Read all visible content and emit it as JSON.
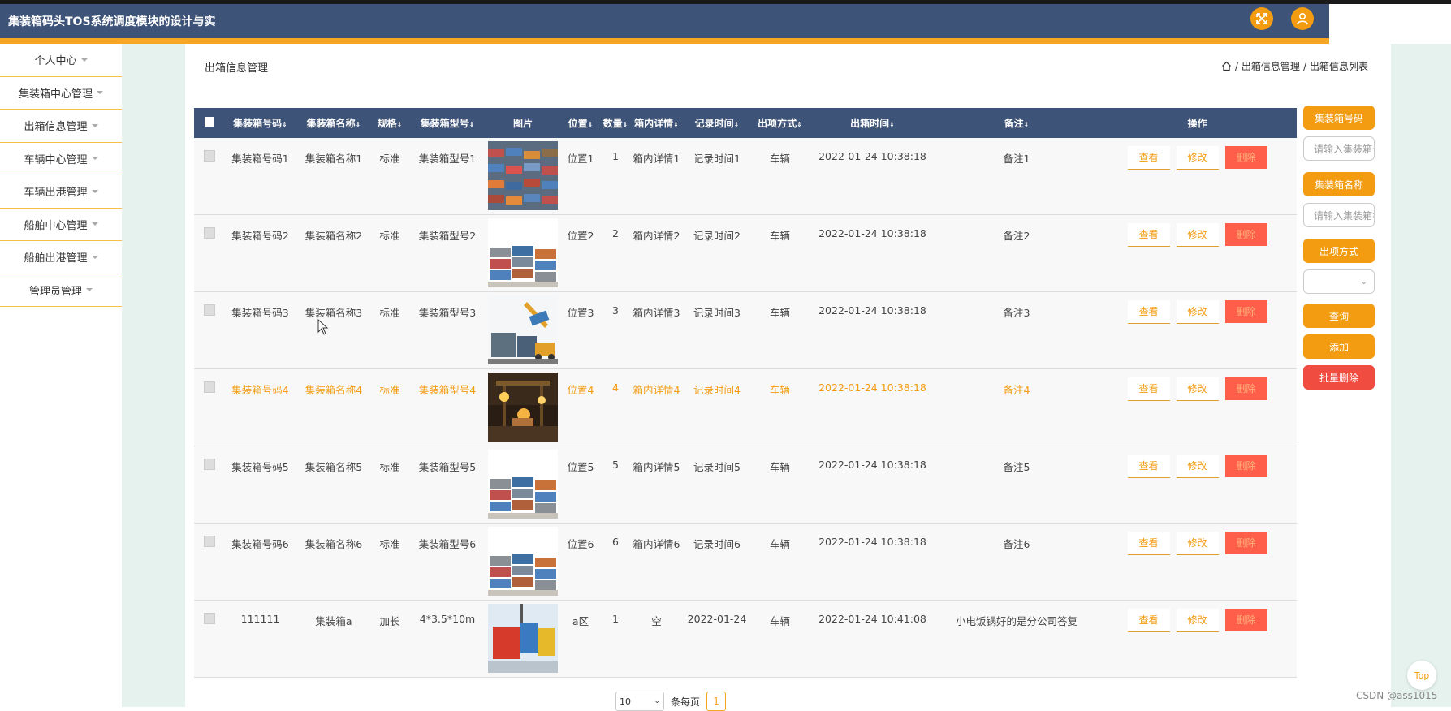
{
  "header": {
    "title": "集装箱码头TOS系统调度模块的设计与实"
  },
  "sidebar": {
    "items": [
      {
        "label": "个人中心"
      },
      {
        "label": "集装箱中心管理"
      },
      {
        "label": "出箱信息管理"
      },
      {
        "label": "车辆中心管理"
      },
      {
        "label": "车辆出港管理"
      },
      {
        "label": "船舶中心管理"
      },
      {
        "label": "船舶出港管理"
      },
      {
        "label": "管理员管理"
      }
    ]
  },
  "page": {
    "title": "出箱信息管理"
  },
  "breadcrumb": {
    "home_sep": "/",
    "level1": "出箱信息管理",
    "sep": "/",
    "level2": "出箱信息列表"
  },
  "table": {
    "headers": {
      "code": "集装箱号码",
      "name": "集装箱名称",
      "spec": "规格",
      "type": "集装箱型号",
      "image": "图片",
      "position": "位置",
      "quantity": "数量",
      "detail": "箱内详情",
      "record_time": "记录时间",
      "method": "出项方式",
      "out_time": "出箱时间",
      "remark": "备注",
      "ops": "操作"
    },
    "sort_glyph": "⇕",
    "rows": [
      {
        "code": "集装箱号码1",
        "name": "集装箱名称1",
        "spec": "标准",
        "type": "集装箱型号1",
        "position": "位置1",
        "quantity": "1",
        "detail": "箱内详情1",
        "record_time": "记录时间1",
        "method": "车辆",
        "out_time": "2022-01-24 10:38:18",
        "remark": "备注1"
      },
      {
        "code": "集装箱号码2",
        "name": "集装箱名称2",
        "spec": "标准",
        "type": "集装箱型号2",
        "position": "位置2",
        "quantity": "2",
        "detail": "箱内详情2",
        "record_time": "记录时间2",
        "method": "车辆",
        "out_time": "2022-01-24 10:38:18",
        "remark": "备注2"
      },
      {
        "code": "集装箱号码3",
        "name": "集装箱名称3",
        "spec": "标准",
        "type": "集装箱型号3",
        "position": "位置3",
        "quantity": "3",
        "detail": "箱内详情3",
        "record_time": "记录时间3",
        "method": "车辆",
        "out_time": "2022-01-24 10:38:18",
        "remark": "备注3"
      },
      {
        "code": "集装箱号码4",
        "name": "集装箱名称4",
        "spec": "标准",
        "type": "集装箱型号4",
        "position": "位置4",
        "quantity": "4",
        "detail": "箱内详情4",
        "record_time": "记录时间4",
        "method": "车辆",
        "out_time": "2022-01-24 10:38:18",
        "remark": "备注4"
      },
      {
        "code": "集装箱号码5",
        "name": "集装箱名称5",
        "spec": "标准",
        "type": "集装箱型号5",
        "position": "位置5",
        "quantity": "5",
        "detail": "箱内详情5",
        "record_time": "记录时间5",
        "method": "车辆",
        "out_time": "2022-01-24 10:38:18",
        "remark": "备注5"
      },
      {
        "code": "集装箱号码6",
        "name": "集装箱名称6",
        "spec": "标准",
        "type": "集装箱型号6",
        "position": "位置6",
        "quantity": "6",
        "detail": "箱内详情6",
        "record_time": "记录时间6",
        "method": "车辆",
        "out_time": "2022-01-24 10:38:18",
        "remark": "备注6"
      },
      {
        "code": "111111",
        "name": "集装箱a",
        "spec": "加长",
        "type": "4*3.5*10m",
        "position": "a区",
        "quantity": "1",
        "detail": "空",
        "record_time": "2022-01-24",
        "method": "车辆",
        "out_time": "2022-01-24 10:41:08",
        "remark": "小电饭锅好的是分公司答复"
      }
    ],
    "action_labels": {
      "view": "查看",
      "edit": "修改",
      "delete": "删除"
    }
  },
  "search": {
    "code_label": "集装箱号码",
    "code_placeholder": "请输入集装箱号码",
    "name_label": "集装箱名称",
    "name_placeholder": "请输入集装箱名称",
    "method_label": "出项方式",
    "method_value": "",
    "query_label": "查询",
    "add_label": "添加",
    "batch_delete_label": "批量删除"
  },
  "pagination": {
    "page_size": "10",
    "per_page_label": "条每页",
    "current_page": "1"
  },
  "misc": {
    "top_label": "Top",
    "watermark": "CSDN @ass1015"
  },
  "colors": {
    "header": "#3d5378",
    "accent": "#f5a623",
    "button": "#f39c12",
    "danger": "#ff5f4a",
    "highlight_row_text": "#f39c12"
  },
  "icons": {
    "fullscreen": "fullscreen-icon",
    "user": "user-icon",
    "home": "home-icon",
    "cursor": "mouse-cursor-icon"
  }
}
